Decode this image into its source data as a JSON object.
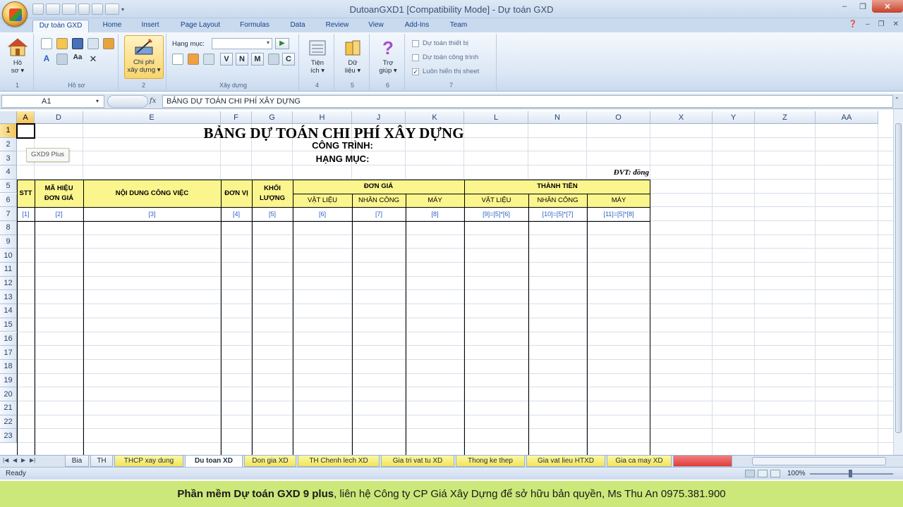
{
  "window": {
    "title": "DutoanGXD1  [Compatibility Mode] - Dự toán GXD",
    "controls": {
      "minimize": "–",
      "maximize": "❐",
      "close": "✕"
    }
  },
  "tabs": [
    "Dự toán GXD",
    "Home",
    "Insert",
    "Page Layout",
    "Formulas",
    "Data",
    "Review",
    "View",
    "Add-Ins",
    "Team"
  ],
  "active_tab": "Dự toán GXD",
  "ribbon": {
    "ho_so": {
      "label1": "Hồ",
      "label2": "sơ ▾",
      "group": "Hồ sơ",
      "group_no": "1"
    },
    "chi_phi": {
      "label1": "Chi phí",
      "label2": "xây dựng ▾",
      "group_no": "2"
    },
    "xay_dung": {
      "hang_muc_label": "Hạng mục:",
      "group": "Xây dựng",
      "letters": [
        "V",
        "N",
        "M",
        "C"
      ]
    },
    "tien_ich": {
      "label1": "Tiện",
      "label2": "ích ▾",
      "group_no": "4"
    },
    "du_lieu": {
      "label1": "Dữ",
      "label2": "liệu ▾",
      "group_no": "5"
    },
    "tro_giup": {
      "label1": "Trợ",
      "label2": "giúp ▾",
      "group_no": "6"
    },
    "options": {
      "items": [
        {
          "label": "Dự toán thiết bị",
          "checked": false
        },
        {
          "label": "Dự toán công trình",
          "checked": false
        },
        {
          "label": "Luôn hiển thị sheet",
          "checked": true
        }
      ],
      "group_no": "7"
    }
  },
  "formula_bar": {
    "name_box": "A1",
    "fx": "fx",
    "formula": "BẢNG DỰ TOÁN CHI PHÍ XÂY DỰNG"
  },
  "columns": [
    "A",
    "D",
    "E",
    "F",
    "G",
    "H",
    "J",
    "K",
    "L",
    "N",
    "O",
    "X",
    "Y",
    "Z",
    "AA"
  ],
  "rows": [
    "1",
    "2",
    "3",
    "4",
    "5",
    "6",
    "7",
    "8",
    "9",
    "10",
    "11",
    "12",
    "13",
    "14",
    "15",
    "16",
    "17",
    "18",
    "19",
    "20",
    "21",
    "22",
    "23"
  ],
  "sheet": {
    "title": "BẢNG DỰ TOÁN CHI PHÍ XÂY DỰNG",
    "cong_trinh": "CÔNG TRÌNH:",
    "hang_muc": "HẠNG MỤC:",
    "dvt": "ĐVT: đồng",
    "headers": {
      "stt": "STT",
      "ma_hieu_1": "MÃ HIỆU",
      "ma_hieu_2": "ĐƠN GIÁ",
      "noi_dung": "NỘI DUNG CÔNG VIỆC",
      "don_vi": "ĐƠN VỊ",
      "khoi_1": "KHỐI",
      "khoi_2": "LƯỢNG",
      "don_gia": "ĐƠN GIÁ",
      "thanh_tien": "THÀNH TIỀN",
      "vat_lieu": "VẬT LIỆU",
      "nhan_cong": "NHÂN CÔNG",
      "may": "MÁY"
    },
    "index_row": [
      "[1]",
      "[2]",
      "[3]",
      "[4]",
      "[5]",
      "[6]",
      "[7]",
      "[8]",
      "[9]=[5]*[6]",
      "[10]=[5]*[7]",
      "[11]=[5]*[8]"
    ]
  },
  "tooltip": "GXD9 Plus",
  "sheet_tabs": [
    {
      "label": "Bia",
      "style": "plain"
    },
    {
      "label": "TH",
      "style": "plain"
    },
    {
      "label": "THCP xay dung",
      "style": "yel"
    },
    {
      "label": "Du toan XD",
      "style": "active"
    },
    {
      "label": "Don gia XD",
      "style": "yel"
    },
    {
      "label": "TH Chenh lech XD",
      "style": "yel"
    },
    {
      "label": "Gia tri vat tu XD",
      "style": "yel"
    },
    {
      "label": "Thong ke thep",
      "style": "yel"
    },
    {
      "label": "Gia vat lieu HTXD",
      "style": "yel"
    },
    {
      "label": "Gia ca may XD",
      "style": "yel"
    }
  ],
  "status": {
    "ready": "Ready",
    "zoom": "100%"
  },
  "banner": {
    "bold": "Phần mềm Dự toán GXD 9 plus",
    "rest": ", liên hệ Công ty CP Giá Xây Dựng để sở hữu bản quyền, Ms Thu An 0975.381.900"
  }
}
